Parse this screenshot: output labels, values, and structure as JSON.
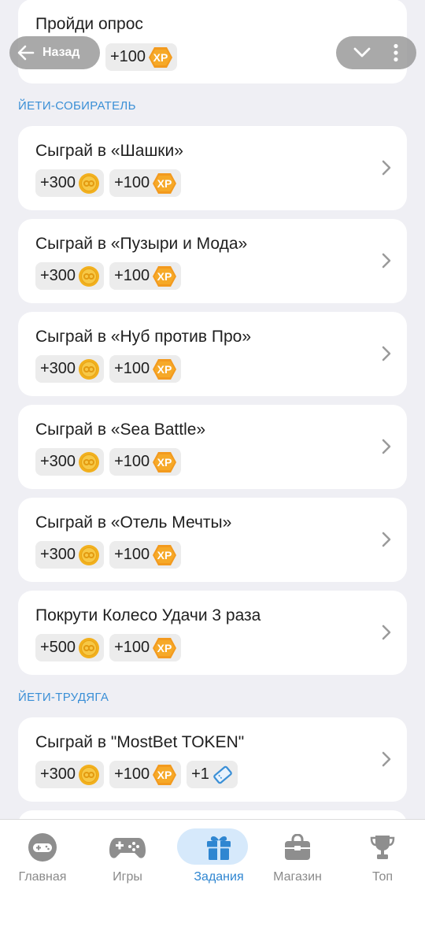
{
  "nav": {
    "back_label": "Назад"
  },
  "sections": [
    {
      "label": "ЙЕТИ-СОБИРАТЕЛЬ"
    },
    {
      "label": "ЙЕТИ-ТРУДЯГА"
    }
  ],
  "colors": {
    "accent": "#2f86d1",
    "coin": "#f2b01d",
    "xp": "#f39a1e",
    "ticket": "#3a8fd6"
  },
  "tasks": [
    {
      "title": "Пройди опрос",
      "xp": "+100"
    },
    {
      "title": "Сыграй в «Шашки»",
      "coins": "+300",
      "xp": "+100"
    },
    {
      "title": "Сыграй в «Пузыри и Мода»",
      "coins": "+300",
      "xp": "+100"
    },
    {
      "title": "Сыграй в «Нуб против Про»",
      "coins": "+300",
      "xp": "+100"
    },
    {
      "title": "Сыграй в «Sea Battle»",
      "coins": "+300",
      "xp": "+100"
    },
    {
      "title": "Сыграй в «Отель Мечты»",
      "coins": "+300",
      "xp": "+100"
    },
    {
      "title": "Покрути Колесо Удачи 3 раза",
      "coins": "+500",
      "xp": "+100"
    },
    {
      "title": "Сыграй в \"MostBet TOKEN\"",
      "coins": "+300",
      "xp": "+100",
      "tickets": "+1"
    }
  ],
  "tabbar": [
    {
      "label": "Главная",
      "icon": "gamepad-round-icon"
    },
    {
      "label": "Игры",
      "icon": "gamepad-icon"
    },
    {
      "label": "Задания",
      "icon": "gift-icon",
      "active": true
    },
    {
      "label": "Магазин",
      "icon": "shop-bag-icon"
    },
    {
      "label": "Топ",
      "icon": "trophy-icon"
    }
  ]
}
